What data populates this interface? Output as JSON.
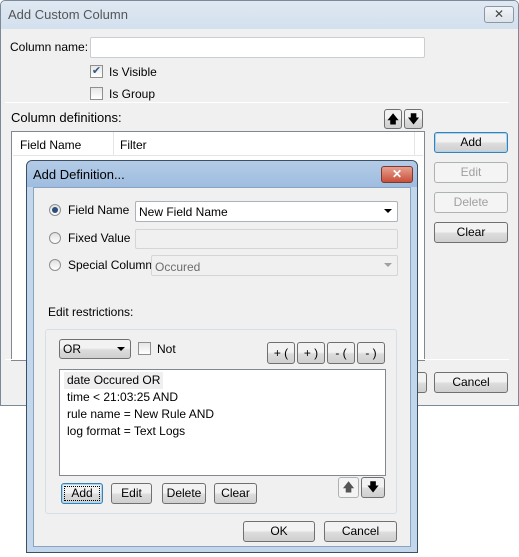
{
  "main_window": {
    "title": "Add Custom Column",
    "column_name_label": "Column name:",
    "column_name_value": "",
    "is_visible": {
      "label": "Is Visible",
      "checked": true
    },
    "is_group": {
      "label": "Is Group",
      "checked": false
    },
    "definitions_label": "Column definitions:",
    "table_headers": [
      "Field Name",
      "Filter"
    ],
    "buttons": {
      "add": "Add",
      "edit": "Edit",
      "delete": "Delete",
      "clear": "Clear",
      "ok": "OK",
      "cancel": "Cancel"
    }
  },
  "dialog": {
    "title": "Add Definition...",
    "field_name": {
      "label": "Field Name",
      "value": "New Field Name",
      "selected": true
    },
    "fixed_value": {
      "label": "Fixed Value",
      "value": ""
    },
    "special_column": {
      "label": "Special Column",
      "value": "Occured"
    },
    "edit_restrictions_label": "Edit restrictions:",
    "operator": "OR",
    "not_label": "Not",
    "paren_buttons": [
      "+ (",
      "+ )",
      "- (",
      "- )"
    ],
    "restrictions": [
      "date Occured  OR",
      "time < 21:03:25 AND",
      "rule name = New Rule AND",
      "log format = Text Logs"
    ],
    "buttons": {
      "add": "Add",
      "edit": "Edit",
      "delete": "Delete",
      "clear": "Clear",
      "ok": "OK",
      "cancel": "Cancel"
    }
  }
}
